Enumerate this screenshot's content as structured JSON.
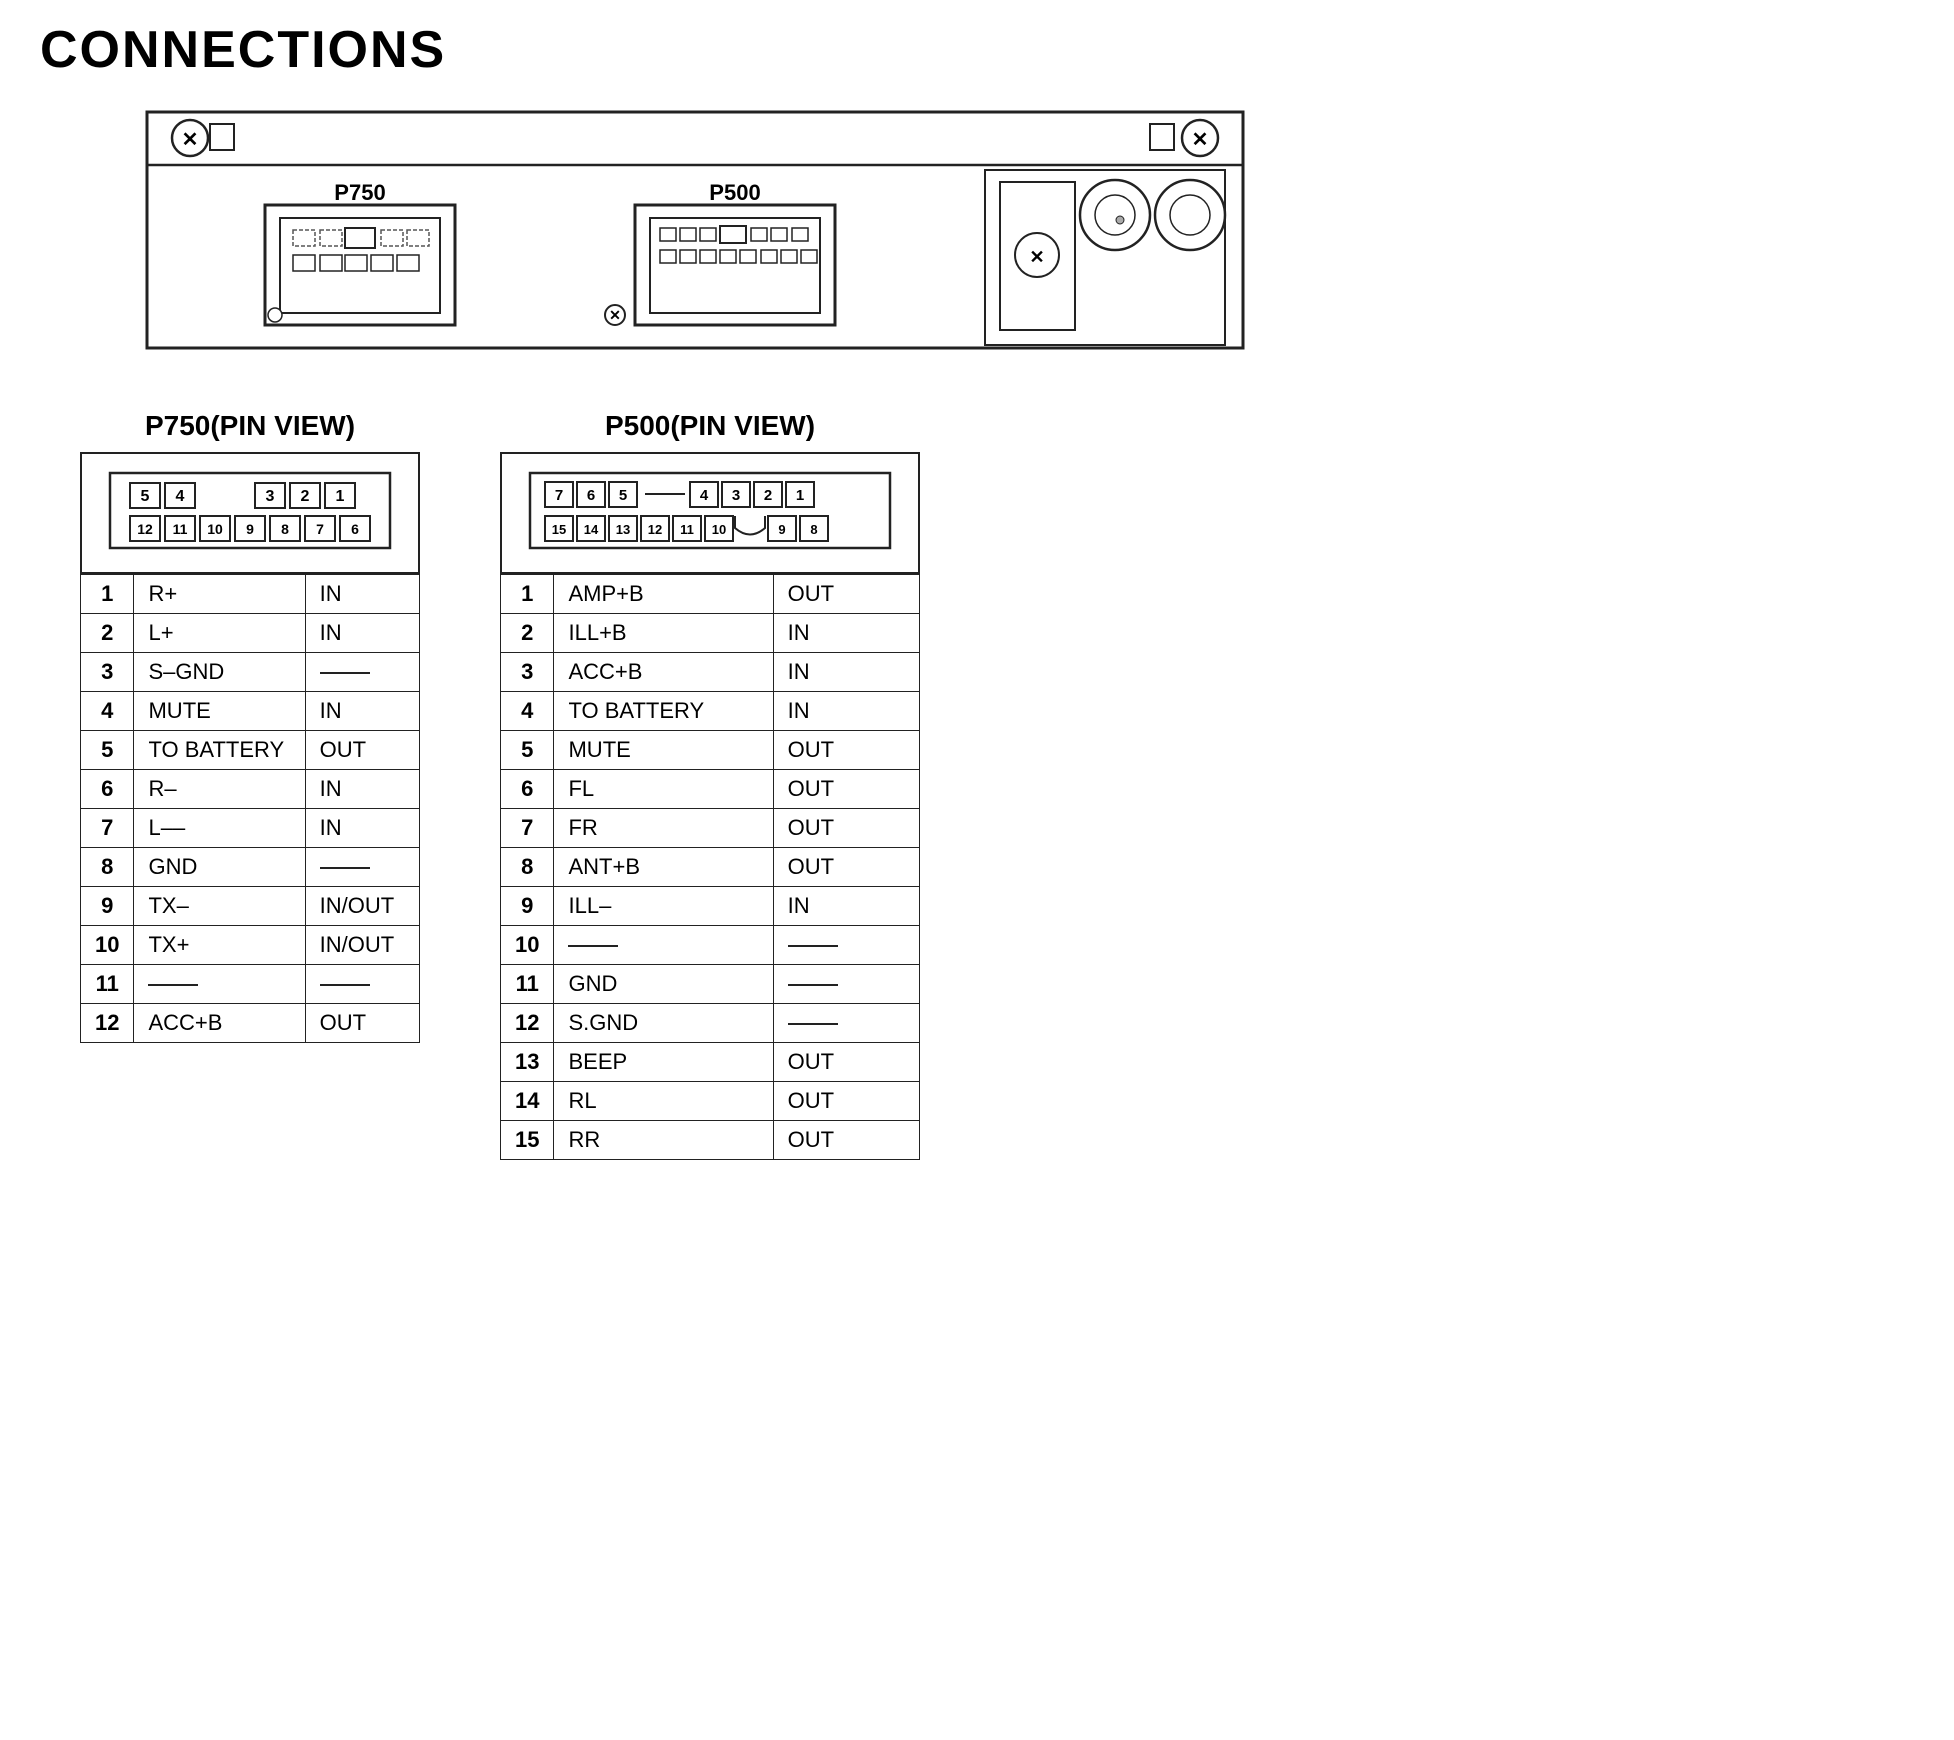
{
  "title": "CONNECTIONS",
  "p750": {
    "label": "P750",
    "pinView": {
      "title": "P750(PIN VIEW)",
      "topRow": [
        "5",
        "4",
        "",
        "3",
        "2",
        "1"
      ],
      "bottomRow": [
        "12",
        "11",
        "10",
        "9",
        "8",
        "7",
        "6"
      ]
    },
    "table": [
      {
        "pin": "1",
        "signal": "R+",
        "dir": "IN"
      },
      {
        "pin": "2",
        "signal": "L+",
        "dir": "IN"
      },
      {
        "pin": "3",
        "signal": "S–GND",
        "dir": "—"
      },
      {
        "pin": "4",
        "signal": "MUTE",
        "dir": "IN"
      },
      {
        "pin": "5",
        "signal": "TO BATTERY",
        "dir": "OUT"
      },
      {
        "pin": "6",
        "signal": "R–",
        "dir": "IN"
      },
      {
        "pin": "7",
        "signal": "L––",
        "dir": "IN"
      },
      {
        "pin": "8",
        "signal": "GND",
        "dir": "—"
      },
      {
        "pin": "9",
        "signal": "TX–",
        "dir": "IN/OUT"
      },
      {
        "pin": "10",
        "signal": "TX+",
        "dir": "IN/OUT"
      },
      {
        "pin": "11",
        "signal": "—",
        "dir": "—"
      },
      {
        "pin": "12",
        "signal": "ACC+B",
        "dir": "OUT"
      }
    ]
  },
  "p500": {
    "label": "P500",
    "pinView": {
      "title": "P500(PIN VIEW)",
      "topRow": [
        "7",
        "6",
        "5",
        "",
        "4",
        "3",
        "2",
        "1"
      ],
      "bottomRow": [
        "15",
        "14",
        "13",
        "12",
        "11",
        "10",
        "",
        "9",
        "8"
      ]
    },
    "table": [
      {
        "pin": "1",
        "signal": "AMP+B",
        "dir": "OUT"
      },
      {
        "pin": "2",
        "signal": "ILL+B",
        "dir": "IN"
      },
      {
        "pin": "3",
        "signal": "ACC+B",
        "dir": "IN"
      },
      {
        "pin": "4",
        "signal": "TO BATTERY",
        "dir": "IN"
      },
      {
        "pin": "5",
        "signal": "MUTE",
        "dir": "OUT"
      },
      {
        "pin": "6",
        "signal": "FL",
        "dir": "OUT"
      },
      {
        "pin": "7",
        "signal": "FR",
        "dir": "OUT"
      },
      {
        "pin": "8",
        "signal": "ANT+B",
        "dir": "OUT"
      },
      {
        "pin": "9",
        "signal": "ILL–",
        "dir": "IN"
      },
      {
        "pin": "10",
        "signal": "—",
        "dir": "—"
      },
      {
        "pin": "11",
        "signal": "GND",
        "dir": "—"
      },
      {
        "pin": "12",
        "signal": "S.GND",
        "dir": "—"
      },
      {
        "pin": "13",
        "signal": "BEEP",
        "dir": "OUT"
      },
      {
        "pin": "14",
        "signal": "RL",
        "dir": "OUT"
      },
      {
        "pin": "15",
        "signal": "RR",
        "dir": "OUT"
      }
    ]
  }
}
